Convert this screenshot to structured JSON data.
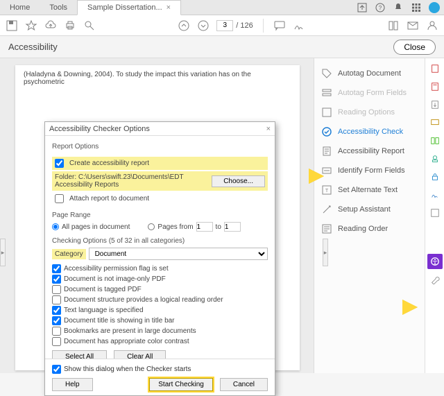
{
  "tabs": {
    "home": "Home",
    "tools": "Tools",
    "doc": "Sample Dissertation..."
  },
  "toolbar": {
    "pagecur": "3",
    "pagetotal": "/  126"
  },
  "panel": {
    "title": "Accessibility",
    "close": "Close"
  },
  "doc_snippet": "(Haladyna & Downing, 2004). To study the impact this variation has on the psychometric",
  "rp": {
    "autotag_doc": "Autotag Document",
    "autotag_form": "Autotag Form Fields",
    "reading_opts": "Reading Options",
    "acc_check": "Accessibility Check",
    "acc_report": "Accessibility Report",
    "identify_ff": "Identify Form Fields",
    "set_alt": "Set Alternate Text",
    "setup": "Setup Assistant",
    "reading_order": "Reading Order"
  },
  "dlg": {
    "title": "Accessibility Checker Options",
    "report_opts": "Report Options",
    "create_report": "Create accessibility report",
    "folder": "Folder: C:\\Users\\swift.23\\Documents\\EDT Accessibility Reports",
    "choose": "Choose...",
    "attach": "Attach report to document",
    "page_range": "Page Range",
    "all_pages": "All pages in document",
    "pages_from": "Pages from",
    "to": "to",
    "from_v": "1",
    "to_v": "1",
    "checking": "Checking Options (5 of 32 in all categories)",
    "category": "Category",
    "cat_val": "Document",
    "c1": "Accessibility permission flag is set",
    "c2": "Document is not image-only PDF",
    "c3": "Document is tagged PDF",
    "c4": "Document structure provides a logical reading order",
    "c5": "Text language is specified",
    "c6": "Document title is showing in title bar",
    "c7": "Bookmarks are present in large documents",
    "c8": "Document has appropriate color contrast",
    "select_all": "Select All",
    "clear_all": "Clear All",
    "show_dialog": "Show this dialog when the Checker starts",
    "help": "Help",
    "start": "Start Checking",
    "cancel": "Cancel"
  }
}
